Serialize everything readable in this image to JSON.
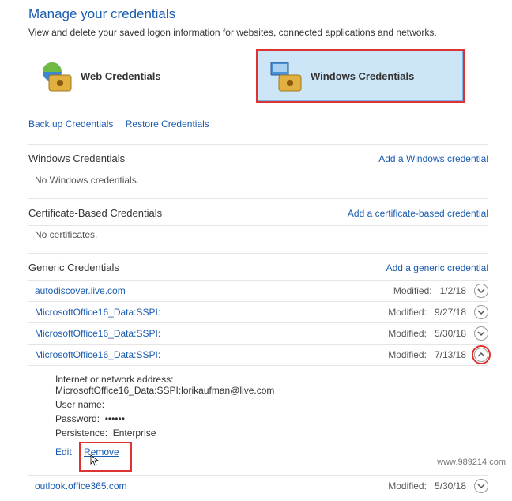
{
  "header": {
    "title": "Manage your credentials",
    "subtitle": "View and delete your saved logon information for websites, connected applications and networks."
  },
  "tabs": {
    "web": {
      "label": "Web Credentials"
    },
    "windows": {
      "label": "Windows Credentials"
    }
  },
  "backupLinks": {
    "backup": "Back up Credentials",
    "restore": "Restore Credentials"
  },
  "sections": {
    "windows": {
      "title": "Windows Credentials",
      "addLink": "Add a Windows credential",
      "empty": "No Windows credentials."
    },
    "certificate": {
      "title": "Certificate-Based Credentials",
      "addLink": "Add a certificate-based credential",
      "empty": "No certificates."
    },
    "generic": {
      "title": "Generic Credentials",
      "addLink": "Add a generic credential",
      "modifiedLabel": "Modified:",
      "items": [
        {
          "name": "autodiscover.live.com",
          "modified": "1/2/18",
          "expanded": false
        },
        {
          "name": "MicrosoftOffice16_Data:SSPI:",
          "modified": "9/27/18",
          "expanded": false
        },
        {
          "name": "MicrosoftOffice16_Data:SSPI:",
          "modified": "5/30/18",
          "expanded": false
        },
        {
          "name": "MicrosoftOffice16_Data:SSPI:",
          "modified": "7/13/18",
          "expanded": true,
          "detail": {
            "addressLabel": "Internet or network address:",
            "addressValue": "MicrosoftOffice16_Data:SSPI:lorikaufman@live.com",
            "usernameLabel": "User name:",
            "usernameValue": "",
            "passwordLabel": "Password:",
            "passwordValue": "••••••",
            "persistenceLabel": "Persistence:",
            "persistenceValue": "Enterprise",
            "editLabel": "Edit",
            "removeLabel": "Remove"
          }
        },
        {
          "name": "outlook.office365.com",
          "modified": "5/30/18",
          "expanded": false
        }
      ]
    }
  },
  "watermark": "www.989214.com"
}
